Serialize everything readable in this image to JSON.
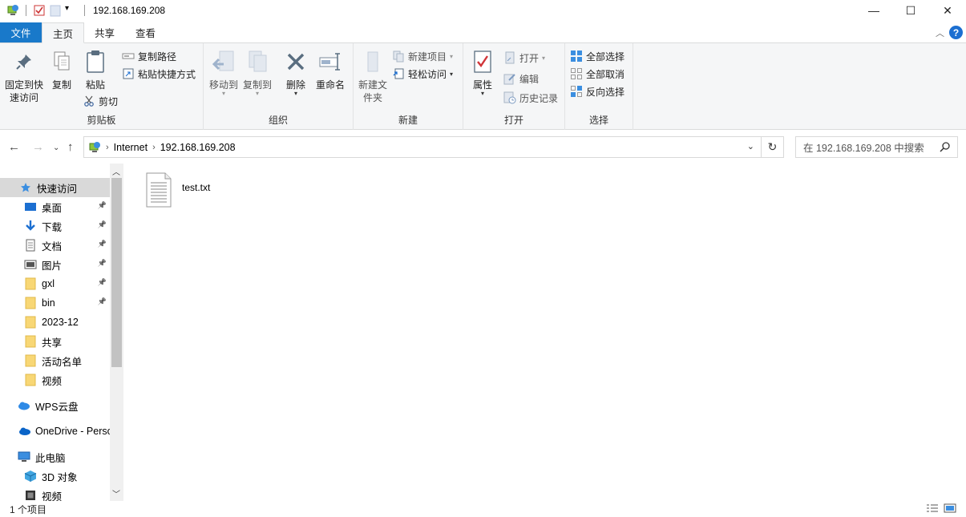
{
  "window": {
    "title": "192.168.169.208",
    "minimize_label": "—",
    "maximize_label": "☐",
    "close_label": "✕"
  },
  "ribbon_tabs": {
    "file": "文件",
    "home": "主页",
    "share": "共享",
    "view": "查看"
  },
  "ribbon": {
    "clipboard": {
      "label": "剪贴板",
      "pin_quick_access": "固定到快速访问",
      "copy": "复制",
      "paste": "粘贴",
      "copy_path": "复制路径",
      "paste_shortcut": "粘贴快捷方式",
      "cut": "剪切"
    },
    "organize": {
      "label": "组织",
      "move_to": "移动到",
      "copy_to": "复制到",
      "delete": "删除",
      "rename": "重命名"
    },
    "new": {
      "label": "新建",
      "new_folder": "新建文件夹",
      "new_item": "新建项目",
      "easy_access": "轻松访问"
    },
    "open": {
      "label": "打开",
      "properties": "属性",
      "open": "打开",
      "edit": "编辑",
      "history": "历史记录"
    },
    "select": {
      "label": "选择",
      "select_all": "全部选择",
      "select_none": "全部取消",
      "invert": "反向选择"
    }
  },
  "address": {
    "crumbs": [
      "Internet",
      "192.168.169.208"
    ],
    "search_placeholder": "在 192.168.169.208 中搜索"
  },
  "nav_pane": {
    "quick_access": "快速访问",
    "items": [
      {
        "label": "桌面",
        "icon": "desktop-icon",
        "pinned": true
      },
      {
        "label": "下载",
        "icon": "download-icon",
        "pinned": true
      },
      {
        "label": "文档",
        "icon": "document-icon",
        "pinned": true
      },
      {
        "label": "图片",
        "icon": "picture-icon",
        "pinned": true
      },
      {
        "label": "gxl",
        "icon": "folder-icon",
        "pinned": true
      },
      {
        "label": "bin",
        "icon": "folder-icon",
        "pinned": true
      },
      {
        "label": "2023-12",
        "icon": "folder-icon",
        "pinned": false
      },
      {
        "label": "共享",
        "icon": "folder-icon",
        "pinned": false
      },
      {
        "label": "活动名单",
        "icon": "folder-icon",
        "pinned": false
      },
      {
        "label": "视频",
        "icon": "folder-icon",
        "pinned": false
      }
    ],
    "wps_cloud": "WPS云盘",
    "onedrive": "OneDrive - Perso",
    "this_pc": "此电脑",
    "objects_3d": "3D 对象",
    "videos": "视频"
  },
  "files": [
    {
      "name": "test.txt",
      "icon": "text-file-icon"
    }
  ],
  "status": {
    "count": "1 个项目"
  },
  "colors": {
    "file_tab": "#1979ca",
    "ribbon_bg": "#f5f6f7",
    "folder": "#f8d775",
    "accent_blue": "#1c6fd1"
  }
}
